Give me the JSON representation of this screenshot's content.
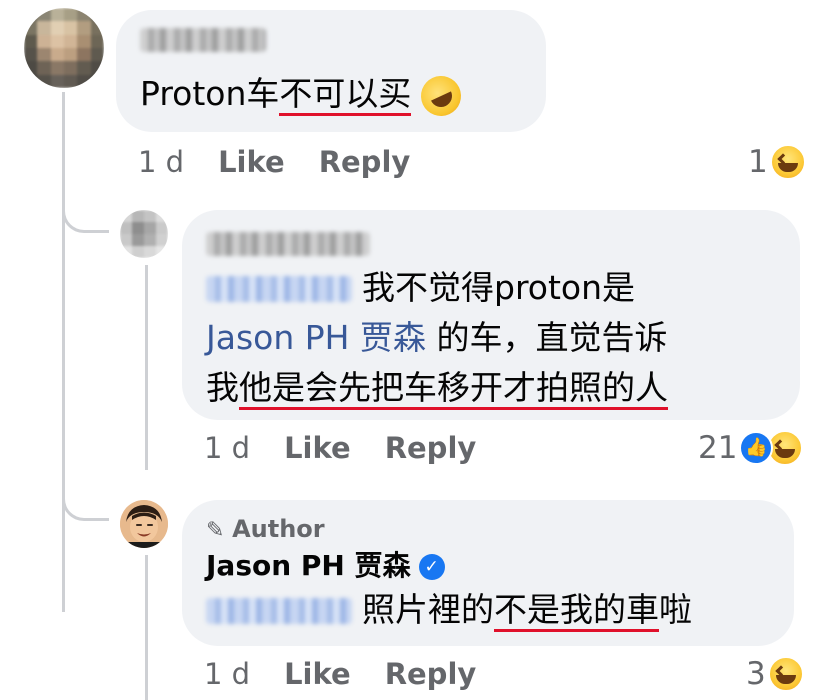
{
  "comments": [
    {
      "author_blurred": true,
      "text_parts": [
        {
          "text": "Proton车",
          "underline": false
        },
        {
          "text": "不可以买",
          "underline": true
        }
      ],
      "emoji_name": "rolling-on-floor-laughing-emoji",
      "time": "1 d",
      "like_label": "Like",
      "reply_label": "Reply",
      "reaction_count": "1",
      "reactions": [
        "haha"
      ]
    },
    {
      "author_blurred": true,
      "mention_blurred": true,
      "line1": "我不觉得proton是",
      "mention2": "Jason PH 贾森",
      "line2_rest": " 的车，直觉告诉",
      "line3_a": "我",
      "line3_underlined": "他是会先把车移开才拍照的人",
      "time": "1 d",
      "like_label": "Like",
      "reply_label": "Reply",
      "reaction_count": "21",
      "reactions": [
        "like",
        "haha"
      ]
    },
    {
      "author_badge": "Author",
      "author_name": "Jason PH 贾森",
      "verified": true,
      "mention_blurred": true,
      "text_a": "照片裡的",
      "text_underlined": "不是我的車",
      "text_b": "啦",
      "time": "1 d",
      "like_label": "Like",
      "reply_label": "Reply",
      "reaction_count": "3",
      "reactions": [
        "haha"
      ]
    }
  ],
  "colors": {
    "bubble": "#f0f2f5",
    "mention": "#385898",
    "underline": "#e0112b",
    "meta": "#65676b",
    "verified": "#1877f2"
  }
}
